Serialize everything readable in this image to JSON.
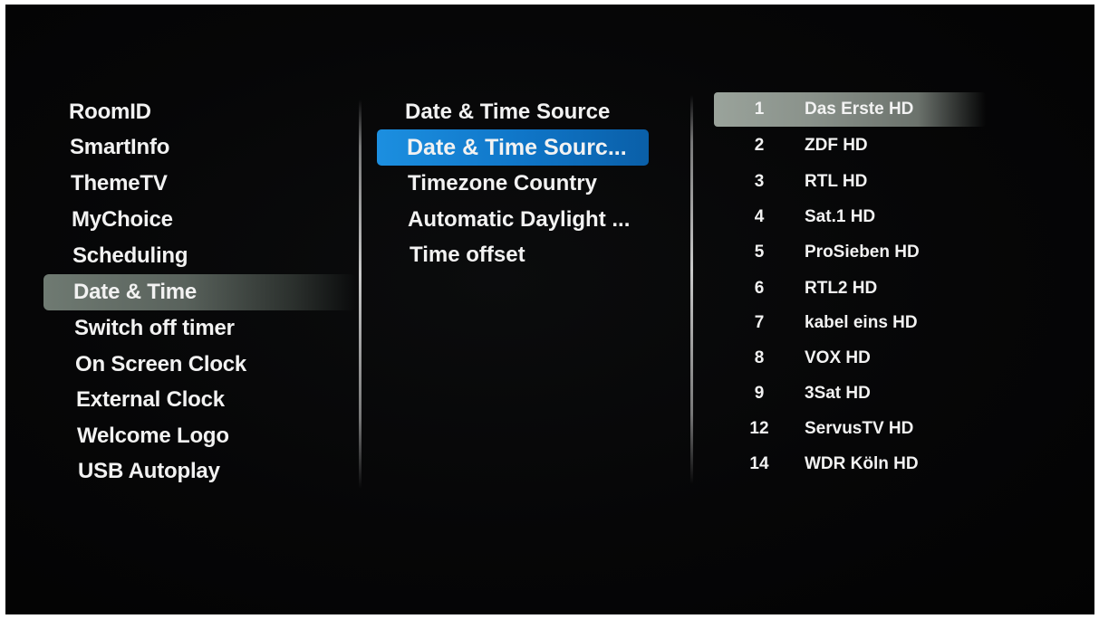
{
  "main_menu": {
    "items": [
      {
        "label": "RoomID"
      },
      {
        "label": "SmartInfo"
      },
      {
        "label": "ThemeTV"
      },
      {
        "label": "MyChoice"
      },
      {
        "label": "Scheduling"
      },
      {
        "label": "Date & Time"
      },
      {
        "label": "Switch off timer"
      },
      {
        "label": "On Screen Clock"
      },
      {
        "label": "External Clock"
      },
      {
        "label": "Welcome Logo"
      },
      {
        "label": "USB Autoplay"
      }
    ],
    "selected": "Date & Time"
  },
  "submenu": {
    "items": [
      {
        "label": "Date & Time Source"
      },
      {
        "label": "Date & Time Sourc..."
      },
      {
        "label": "Timezone Country"
      },
      {
        "label": "Automatic Daylight ..."
      },
      {
        "label": "Time offset"
      }
    ],
    "focused": "Date & Time Sourc..."
  },
  "channels": {
    "items": [
      {
        "number": "1",
        "name": "Das Erste HD"
      },
      {
        "number": "2",
        "name": "ZDF HD"
      },
      {
        "number": "3",
        "name": "RTL HD"
      },
      {
        "number": "4",
        "name": "Sat.1 HD"
      },
      {
        "number": "5",
        "name": "ProSieben HD"
      },
      {
        "number": "6",
        "name": "RTL2 HD"
      },
      {
        "number": "7",
        "name": "kabel eins HD"
      },
      {
        "number": "8",
        "name": "VOX HD"
      },
      {
        "number": "9",
        "name": "3Sat HD"
      },
      {
        "number": "12",
        "name": "ServusTV HD"
      },
      {
        "number": "14",
        "name": "WDR Köln HD"
      }
    ],
    "selected": "Das Erste HD"
  },
  "colors": {
    "background": "#050505",
    "text": "#f2f2f2",
    "focus_blue": "#1583d6",
    "selection_gray": "#7f8880"
  }
}
